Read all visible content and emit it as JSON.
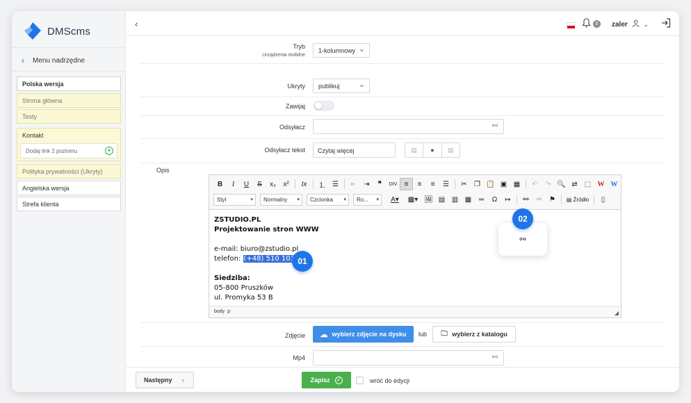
{
  "app": {
    "name": "DMScms"
  },
  "sidebar": {
    "back_label": "Menu nadrzędne",
    "items": [
      {
        "label": "Polska wersja",
        "state": "active"
      },
      {
        "label": "Strona główna",
        "state": "hidden"
      },
      {
        "label": "Testy",
        "state": "hidden"
      },
      {
        "label": "Kontakt",
        "state": "hidden",
        "sub_add": "Dodaj link 2 poziomu"
      },
      {
        "label": "Polityka prywatności (Ukryty)",
        "state": "hidden"
      },
      {
        "label": "Angielska wersja",
        "state": "normal"
      },
      {
        "label": "Strefa klienta",
        "state": "normal"
      }
    ]
  },
  "topbar": {
    "notifications_count": "0",
    "username": "zaler"
  },
  "form": {
    "tryb": {
      "label": "Tryb",
      "sublabel": "Urządzenia mobilne",
      "value": "1-kolumnowy"
    },
    "ukryty": {
      "label": "Ukryty",
      "value": "publikuj"
    },
    "zawijaj": {
      "label": "Zawijaj",
      "on": false
    },
    "odsylacz": {
      "label": "Odsyłacz",
      "value": ""
    },
    "odsylacz_tekst": {
      "label": "Odsyłacz tekst",
      "value": "Czytaj więcej"
    },
    "opis": {
      "label": "Opis"
    },
    "zdjecie": {
      "label": "Zdjęcie",
      "upload_label": "wybierz zdjęcie na dysku",
      "or_label": "lub",
      "catalog_label": "wybierz z katalogu"
    },
    "mp4": {
      "label": "Mp4",
      "value": ""
    }
  },
  "editor": {
    "combos": [
      "Styl",
      "Normalny",
      "Czcionka",
      "Ro..."
    ],
    "source_label": "Źródło",
    "content": {
      "line1": "ZSTUDIO.PL",
      "line2": "Projektowanie stron WWW",
      "line3": "e-mail: biuro@zstudio.pl",
      "line4_prefix": "telefon: ",
      "line4_selected": "(+48) 510 103 487",
      "line5": "Siedziba:",
      "line6": "05-800 Pruszków",
      "line7": "ul. Promyka 53 B"
    },
    "status_path": "body  p"
  },
  "callouts": {
    "first": "01",
    "second": "02"
  },
  "footer": {
    "next_label": "Następny",
    "save_label": "Zapisz",
    "back_to_edit_label": "wróć do edycji"
  },
  "colors": {
    "accent": "#3f8ee8",
    "save": "#4bb04b",
    "hidden_item_bg": "#fbf8d6",
    "callout": "#1f75e6"
  }
}
